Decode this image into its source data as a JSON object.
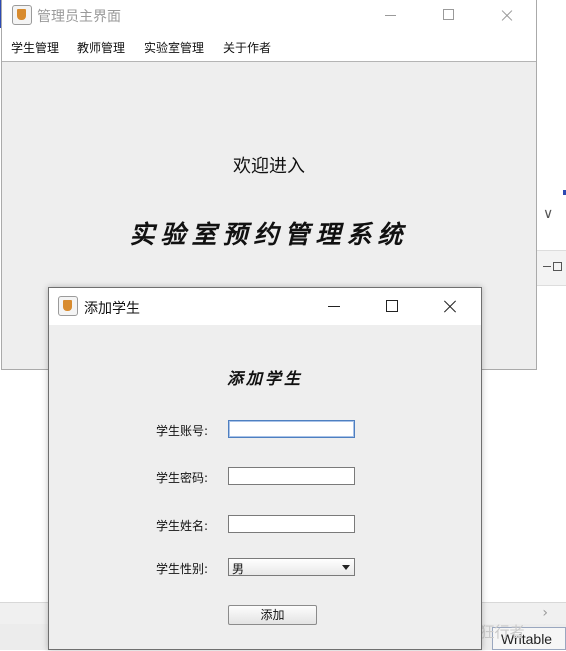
{
  "main_window": {
    "title": "管理员主界面",
    "menu": [
      "学生管理",
      "教师管理",
      "实验室管理",
      "关于作者"
    ],
    "welcome_text": "欢迎进入",
    "system_name": "实验室预约管理系统"
  },
  "dialog": {
    "title": "添加学生",
    "heading": "添加学生",
    "fields": {
      "account_label": "学生账号:",
      "account_value": "",
      "password_label": "学生密码:",
      "password_value": "",
      "name_label": "学生姓名:",
      "name_value": "",
      "gender_label": "学生性别:",
      "gender_value": "男"
    },
    "submit_label": "添加"
  },
  "ide": {
    "status_writable": "Writable",
    "watermark": "CSDN @疯狂行者"
  },
  "colors": {
    "window_bg": "#eeeeee",
    "focus_border": "#4e7fc0"
  }
}
